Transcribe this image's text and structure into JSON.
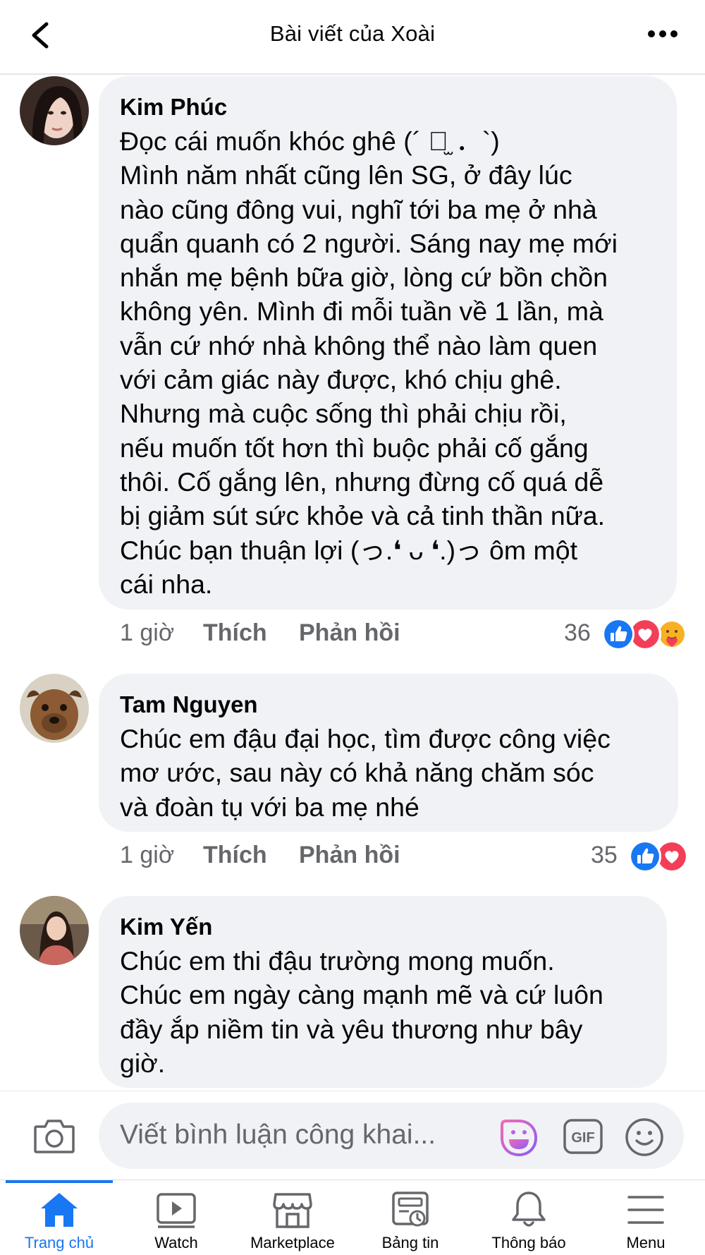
{
  "header": {
    "title": "Bài viết của Xoài"
  },
  "comments": [
    {
      "author": "Kim Phúc",
      "text": "Đọc cái muốn khóc ghê (´ ．̫ ．`)\nMình năm nhất cũng lên SG, ở đây lúc\nnào cũng đông vui, nghĩ tới ba mẹ ở nhà\nquẩn quanh có 2 người. Sáng nay mẹ mới\nnhắn mẹ bệnh bữa giờ, lòng cứ bồn chồn\nkhông yên. Mình đi mỗi tuần về 1 lần, mà\nvẫn cứ nhớ nhà không thể nào làm quen\nvới cảm giác này được, khó chịu ghê.\nNhưng mà cuộc sống thì phải chịu rồi,\nnếu muốn tốt hơn thì buộc phải cố gắng\nthôi. Cố gắng lên, nhưng đừng cố quá dễ\nbị giảm sút sức khỏe và cả tinh thần nữa.\nChúc bạn thuận lợi (っ.❛ ᴗ ❛.)っ  ôm một\ncái nha.",
      "time": "1 giờ",
      "like_label": "Thích",
      "reply_label": "Phản hồi",
      "reaction_count": "36",
      "reactions": [
        "like-icon",
        "love-icon",
        "care-icon"
      ]
    },
    {
      "author": "Tam Nguyen",
      "text": "Chúc em đậu đại học, tìm được công việc\nmơ ước, sau này có khả năng chăm sóc\nvà đoàn tụ với ba mẹ nhé",
      "time": "1 giờ",
      "like_label": "Thích",
      "reply_label": "Phản hồi",
      "reaction_count": "35",
      "reactions": [
        "like-icon",
        "love-icon"
      ]
    },
    {
      "author": "Kim Yến",
      "text": "Chúc em thi đậu trường mong muốn.\nChúc em ngày càng mạnh mẽ và cứ luôn\nđầy ắp niềm tin và yêu thương như bây\ngiờ."
    }
  ],
  "composer": {
    "placeholder": "Viết bình luận công khai...",
    "gif_label": "GIF"
  },
  "tabs": [
    {
      "label": "Trang chủ",
      "icon": "home-icon",
      "active": true
    },
    {
      "label": "Watch",
      "icon": "watch-icon",
      "active": false
    },
    {
      "label": "Marketplace",
      "icon": "marketplace-icon",
      "active": false
    },
    {
      "label": "Bảng tin",
      "icon": "news-icon",
      "active": false
    },
    {
      "label": "Thông báo",
      "icon": "bell-icon",
      "active": false
    },
    {
      "label": "Menu",
      "icon": "menu-icon",
      "active": false
    }
  ],
  "colors": {
    "accent": "#1877f2",
    "bubble": "#f0f2f5",
    "secondary_text": "#65676b",
    "love": "#f33e58",
    "care": "#f7b125"
  }
}
